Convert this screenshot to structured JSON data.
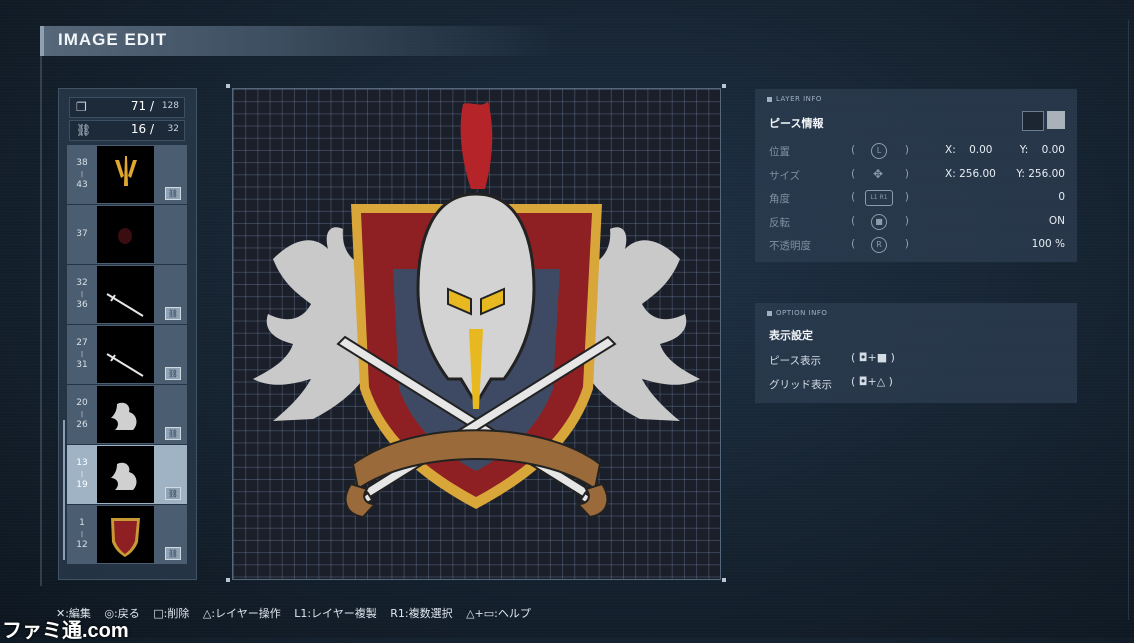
{
  "title": "IMAGE EDIT",
  "counters": {
    "pieces": {
      "value": "71 /",
      "max": "128"
    },
    "links": {
      "value": "16 /",
      "max": "32"
    }
  },
  "layers": [
    {
      "top": "38",
      "bottom": "43",
      "thumb": "trident-emblem",
      "linked": true
    },
    {
      "top": "37",
      "bottom": "",
      "thumb": "red-dot",
      "linked": false
    },
    {
      "top": "32",
      "bottom": "36",
      "thumb": "sword",
      "linked": true
    },
    {
      "top": "27",
      "bottom": "31",
      "thumb": "sword",
      "linked": true
    },
    {
      "top": "20",
      "bottom": "26",
      "thumb": "dragon",
      "linked": true
    },
    {
      "top": "13",
      "bottom": "19",
      "thumb": "dragon",
      "linked": true,
      "selected": true
    },
    {
      "top": "1",
      "bottom": "12",
      "thumb": "shield",
      "linked": true
    }
  ],
  "layer_info": {
    "header": "LAYER INFO",
    "section": "ピース情報",
    "rows": [
      {
        "label": "位置",
        "glyph": "L",
        "x_label": "X:",
        "x": "0.00",
        "y_label": "Y:",
        "y": "0.00"
      },
      {
        "label": "サイズ",
        "glyph": "✥",
        "x_label": "X:",
        "x": "256.00",
        "y_label": "Y:",
        "y": "256.00"
      },
      {
        "label": "角度",
        "glyph": "L1 R1",
        "value": "0"
      },
      {
        "label": "反転",
        "glyph": "■",
        "value": "ON"
      },
      {
        "label": "不透明度",
        "glyph": "R",
        "value": "100 %"
      }
    ]
  },
  "option_info": {
    "header": "OPTION INFO",
    "section": "表示設定",
    "rows": [
      {
        "label": "ピース表示",
        "combo": "( ◘+■ )"
      },
      {
        "label": "グリッド表示",
        "combo": "( ◘+△ )"
      }
    ]
  },
  "help_bar": [
    "✕:編集",
    "◎:戻る",
    "□:削除",
    "△:レイヤー操作",
    "L1:レイヤー複製",
    "R1:複数選択",
    "△+▭:ヘルプ"
  ],
  "watermark": "ファミ通.com",
  "colors": {
    "accent": "#9fb3c4",
    "shield_red": "#8e1f22",
    "gold": "#d9a63a",
    "plume": "#b52428"
  }
}
